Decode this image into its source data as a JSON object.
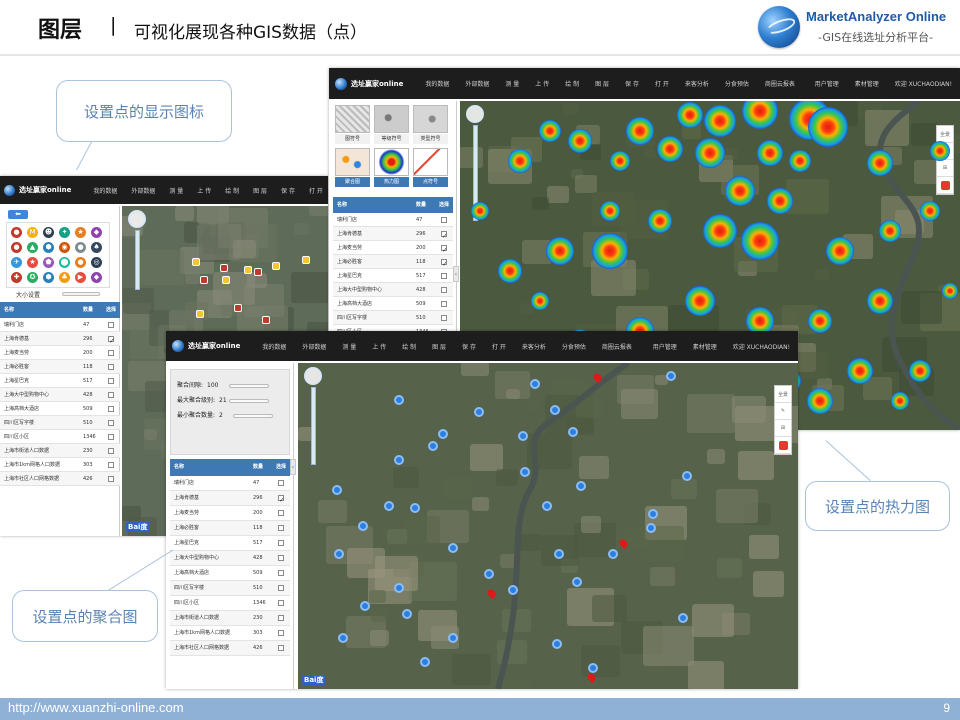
{
  "slide": {
    "title": "图层",
    "separator": "|",
    "subtitle": "可视化展现各种GIS数据（点）",
    "brand_name": "MarketAnalyzer Online",
    "brand_tagline": "-GIS在线选址分析平台-",
    "footer_url": "http://www.xuanzhi-online.com",
    "page_number": "9"
  },
  "callouts": {
    "icons": "设置点的显示图标",
    "heatmap": "设置点的热力图",
    "cluster": "设置点的聚合图"
  },
  "nav": {
    "logo": "选址赢家online",
    "items": [
      "我的数据",
      "外部数据",
      "测 量",
      "上 传",
      "绘 制",
      "图 层",
      "保 存",
      "打 开",
      "来客分析",
      "分食预估",
      "商圈云报表"
    ],
    "right_items": [
      "用户管理",
      "素材管理",
      "欢迎 XUCHAODIAN!"
    ]
  },
  "windows": {
    "icons_panel": {
      "size_setting_label": "大小设置"
    },
    "heat_panel": {
      "style_labels": [
        "图符号",
        "等级符号",
        "类型符号",
        "聚合图",
        "热力图",
        "点符号"
      ]
    },
    "cluster_panel": {
      "settings": [
        {
          "label": "聚合间隙:",
          "value": "100"
        },
        {
          "label": "最大聚合级别:",
          "value": "21"
        },
        {
          "label": "最小聚合数量:",
          "value": "2"
        }
      ]
    }
  },
  "table": {
    "headers": [
      "名称",
      "数量",
      "选择"
    ],
    "rows": [
      {
        "name": "瑞利门店",
        "count": "47",
        "checked": false
      },
      {
        "name": "上海肯德基",
        "count": "296",
        "checked": true
      },
      {
        "name": "上海麦当劳",
        "count": "200",
        "checked": false
      },
      {
        "name": "上海必胜客",
        "count": "118",
        "checked": false
      },
      {
        "name": "上海星巴克",
        "count": "517",
        "checked": false
      },
      {
        "name": "上海大中型购物中心",
        "count": "428",
        "checked": false
      },
      {
        "name": "上海高档大酒店",
        "count": "509",
        "checked": false
      },
      {
        "name": "四川区写字楼",
        "count": "510",
        "checked": false
      },
      {
        "name": "四川区小区",
        "count": "1346",
        "checked": false
      },
      {
        "name": "上海市街道人口数据",
        "count": "230",
        "checked": false
      },
      {
        "name": "上海市1km网格人口数据",
        "count": "303",
        "checked": false
      },
      {
        "name": "上海市社区人口网格数据",
        "count": "426",
        "checked": false
      }
    ],
    "heat_checked": [
      false,
      true,
      true,
      true,
      false,
      false,
      false,
      false,
      false
    ]
  },
  "map": {
    "baidu": "Bai度",
    "tool_labels": [
      "全景",
      "画"
    ]
  },
  "colors": {
    "nav_bg": "#1d1d1d",
    "table_header": "#3f79b3",
    "footer": "#8fb1d6",
    "callout_text": "#5a83b5",
    "brand": "#1f5aa6"
  }
}
